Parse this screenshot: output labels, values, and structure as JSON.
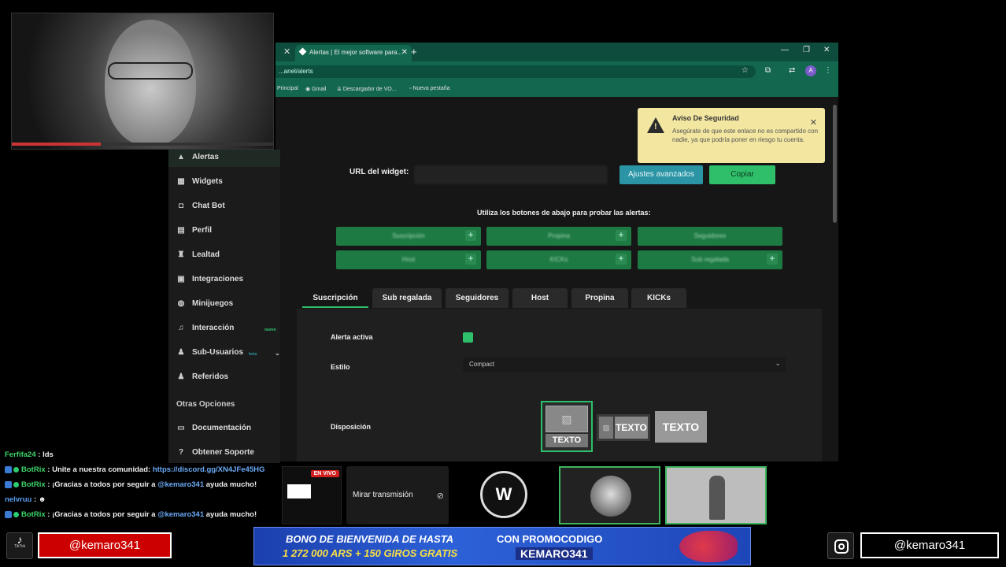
{
  "browser": {
    "tab_title": "Alertas | El mejor software para...",
    "url": "...anel/alerts",
    "bookmarks": [
      "Principal",
      "Gmail",
      "Descargador de VO...",
      "Nueva pestaña"
    ],
    "profile_initial": "A"
  },
  "sidebar": {
    "items": [
      {
        "label": "Alertas",
        "icon": "warning-icon"
      },
      {
        "label": "Widgets",
        "icon": "grid-icon"
      },
      {
        "label": "Chat Bot",
        "icon": "robot-icon"
      },
      {
        "label": "Perfil",
        "icon": "id-card-icon"
      },
      {
        "label": "Lealtad",
        "icon": "trophy-icon"
      },
      {
        "label": "Integraciones",
        "icon": "plug-icon"
      },
      {
        "label": "Minijuegos",
        "icon": "gamepad-icon"
      },
      {
        "label": "Interacción",
        "icon": "music-note-icon",
        "badge": "nuevo"
      },
      {
        "label": "Sub-Usuarios",
        "icon": "users-icon",
        "badge": "beta"
      },
      {
        "label": "Referidos",
        "icon": "users-icon"
      }
    ],
    "section_title": "Otras Opciones",
    "other_items": [
      {
        "label": "Documentación",
        "icon": "document-icon"
      },
      {
        "label": "Obtener Soporte",
        "icon": "help-icon"
      }
    ]
  },
  "main": {
    "url_label": "URL del widget:",
    "advanced_button": "Ajustes avanzados",
    "copy_button": "Copiar",
    "instructions": "Utiliza los botones de abajo para probar las alertas:",
    "test_buttons": [
      "Suscripción",
      "Propina",
      "Seguidores",
      "Host",
      "KICKs",
      "Sub regalada"
    ],
    "tabs": [
      "Suscripción",
      "Sub regalada",
      "Seguidores",
      "Host",
      "Propina",
      "KICKs"
    ],
    "active_tab": "Suscripción",
    "fields": {
      "active_label": "Alerta activa",
      "style_label": "Estilo",
      "style_value": "Compact",
      "layout_label": "Disposición",
      "layout_text": "TEXTO"
    }
  },
  "toast": {
    "title": "Aviso De Seguridad",
    "body": "Asegúrate de que este enlace no es compartido con nadie, ya que podría poner en riesgo tu cuenta."
  },
  "chat": [
    {
      "user": "Ferfifa24",
      "message": "lds",
      "badges": false
    },
    {
      "user": "BotRix",
      "message": "Unite a nuestra comunidad:",
      "link": "https://discord.gg/XN4JFe45HG",
      "badges": true
    },
    {
      "user": "BotRix",
      "message": "¡Gracias a todos por seguir a",
      "mention": "@kemaro341",
      "suffix": "ayuda mucho!",
      "badges": true
    },
    {
      "user": "nelvruu",
      "message": "",
      "badges": false
    },
    {
      "user": "BotRix",
      "message": "¡Gracias a todos por seguir a",
      "mention": "@kemaro341",
      "suffix": "ayuda mucho!",
      "badges": true
    }
  ],
  "overlay": {
    "live_badge": "EN VIVO",
    "watch_button": "Mirar transmisión",
    "tiktok_label": "TikTok",
    "tiktok_handle": "@kemaro341",
    "instagram_handle": "@kemaro341",
    "promo": {
      "line1": "BONO DE BIENVENIDA DE HASTA",
      "line2": "1 272 000 ARS + 150 GIROS GRATIS",
      "code_label": "CON PROMOCODIGO",
      "code": "KEMARO341"
    }
  },
  "colors": {
    "accent_green": "#2fbf6a",
    "teal": "#2b95a5",
    "browser_chrome": "#13674f",
    "warning": "#f2e6a0"
  }
}
